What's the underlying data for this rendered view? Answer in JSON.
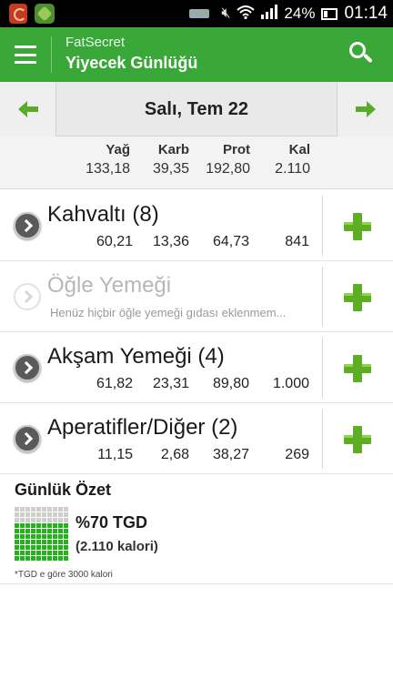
{
  "status_bar": {
    "battery_percent": "24%",
    "time": "01:14",
    "icons": [
      "app-notification-icon",
      "app-notification-icon",
      "keyboard-icon",
      "mute-icon",
      "wifi-icon",
      "signal-icon",
      "battery-icon"
    ]
  },
  "header": {
    "app_name": "FatSecret",
    "title": "Yiyecek Günlüğü"
  },
  "date_nav": {
    "date": "Salı, Tem 22"
  },
  "totals": {
    "headers": [
      "Yağ",
      "Karb",
      "Prot",
      "Kal"
    ],
    "values": [
      "133,18",
      "39,35",
      "192,80",
      "2.110"
    ]
  },
  "meals": [
    {
      "name": "Kahvaltı (8)",
      "values": [
        "60,21",
        "13,36",
        "64,73",
        "841"
      ],
      "empty": false
    },
    {
      "name": "Öğle Yemeği",
      "placeholder": "Henüz hiçbir öğle yemeği gıdası eklenmem...",
      "empty": true
    },
    {
      "name": "Akşam Yemeği (4)",
      "values": [
        "61,82",
        "23,31",
        "89,80",
        "1.000"
      ],
      "empty": false
    },
    {
      "name": "Aperatifler/Diğer (2)",
      "values": [
        "11,15",
        "2,68",
        "38,27",
        "269"
      ],
      "empty": false
    }
  ],
  "summary": {
    "title": "Günlük Özet",
    "percent_text": "%70 TGD",
    "calories_text": "(2.110 kalori)",
    "footnote": "*TGD e göre 3000 kalori",
    "filled_fraction": 0.7
  },
  "colors": {
    "action_bar": "#3aa838",
    "accent_green": "#5dae24"
  }
}
